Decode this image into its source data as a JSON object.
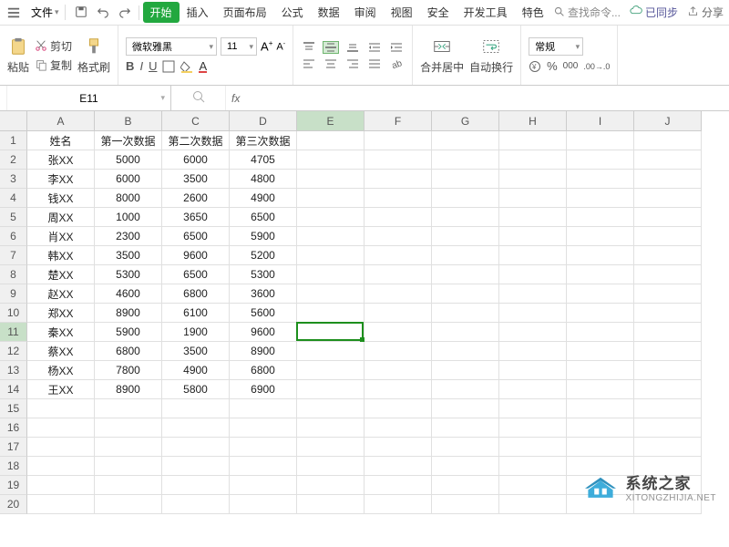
{
  "menu": {
    "file": "文件",
    "tabs": [
      "开始",
      "插入",
      "页面布局",
      "公式",
      "数据",
      "审阅",
      "视图",
      "安全",
      "开发工具",
      "特色"
    ],
    "active_tab": 0,
    "search_placeholder": "查找命令...",
    "sync": "已同步",
    "share": "分享"
  },
  "ribbon": {
    "paste": "粘贴",
    "cut": "剪切",
    "copy": "复制",
    "format_painter": "格式刷",
    "font_name": "微软雅黑",
    "font_size": "11",
    "merge": "合并居中",
    "wrap": "自动换行",
    "number_format": "常规"
  },
  "namebox": "E11",
  "sheet": {
    "columns": [
      "A",
      "B",
      "C",
      "D",
      "E",
      "F",
      "G",
      "H",
      "I",
      "J"
    ],
    "selected_col_index": 4,
    "selected_row_index": 10,
    "headers": [
      "姓名",
      "第一次数据",
      "第二次数据",
      "第三次数据"
    ],
    "rows": [
      {
        "name": "张XX",
        "d1": "5000",
        "d2": "6000",
        "d3": "4705"
      },
      {
        "name": "李XX",
        "d1": "6000",
        "d2": "3500",
        "d3": "4800"
      },
      {
        "name": "钱XX",
        "d1": "8000",
        "d2": "2600",
        "d3": "4900"
      },
      {
        "name": "周XX",
        "d1": "1000",
        "d2": "3650",
        "d3": "6500"
      },
      {
        "name": "肖XX",
        "d1": "2300",
        "d2": "6500",
        "d3": "5900"
      },
      {
        "name": "韩XX",
        "d1": "3500",
        "d2": "9600",
        "d3": "5200"
      },
      {
        "name": "楚XX",
        "d1": "5300",
        "d2": "6500",
        "d3": "5300"
      },
      {
        "name": "赵XX",
        "d1": "4600",
        "d2": "6800",
        "d3": "3600"
      },
      {
        "name": "郑XX",
        "d1": "8900",
        "d2": "6100",
        "d3": "5600"
      },
      {
        "name": "秦XX",
        "d1": "5900",
        "d2": "1900",
        "d3": "9600"
      },
      {
        "name": "蔡XX",
        "d1": "6800",
        "d2": "3500",
        "d3": "8900"
      },
      {
        "name": "杨XX",
        "d1": "7800",
        "d2": "4900",
        "d3": "6800"
      },
      {
        "name": "王XX",
        "d1": "8900",
        "d2": "5800",
        "d3": "6900"
      }
    ],
    "empty_rows": 6
  },
  "watermark": {
    "title": "系统之家",
    "url": "XITONGZHIJIA.NET"
  }
}
